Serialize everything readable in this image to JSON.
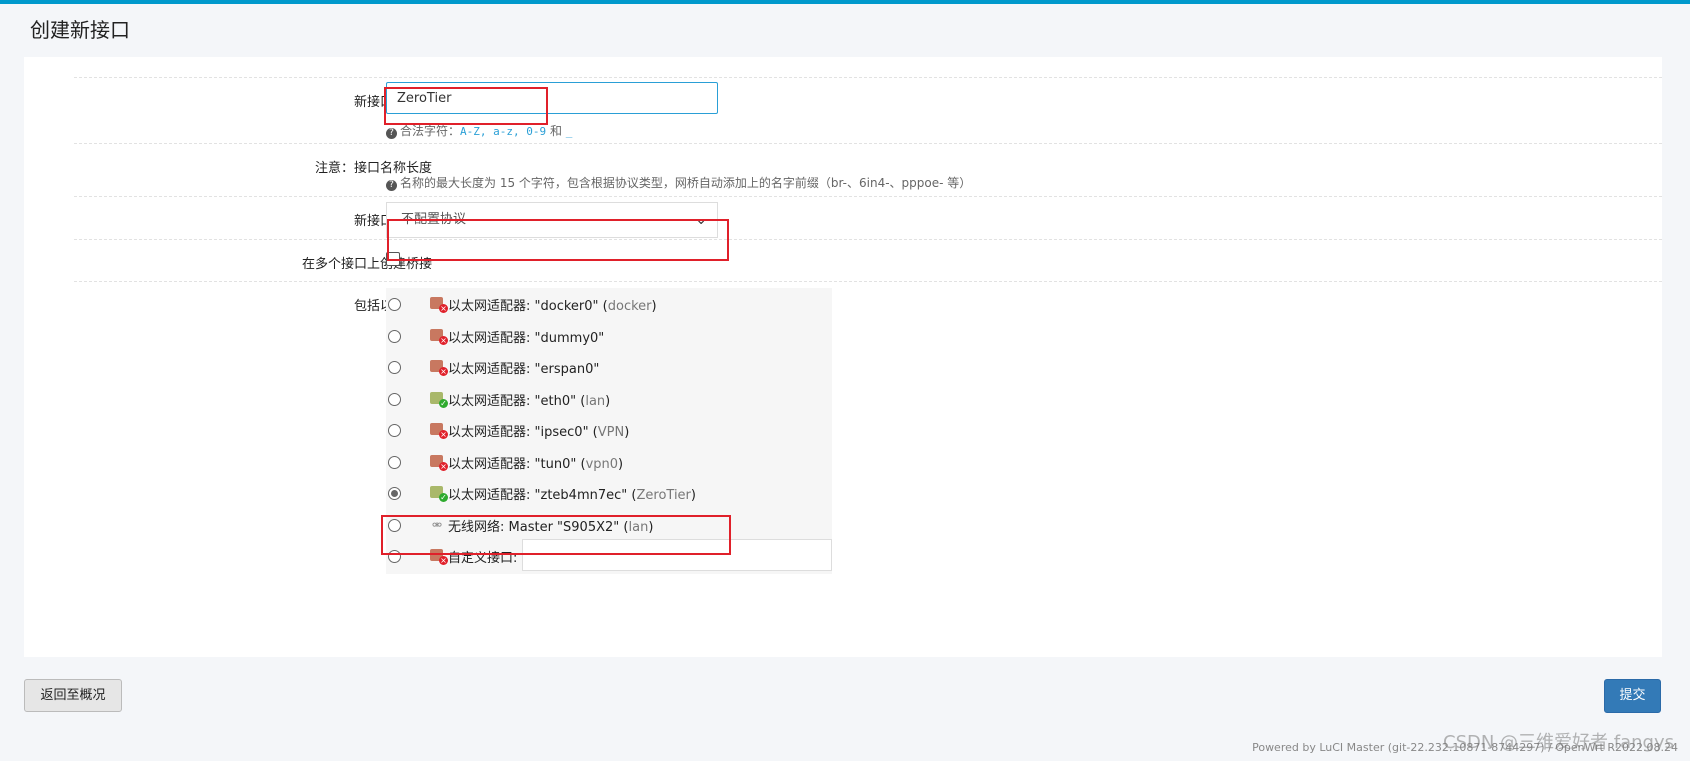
{
  "header": {
    "title": "创建新接口"
  },
  "fields": {
    "name": {
      "label": "新接口的名称",
      "value": "ZeroTier",
      "help_prefix": "合法字符：",
      "help_codes": "A-Z, a-z, 0-9",
      "help_and": "和",
      "help_underscore": "_"
    },
    "note": {
      "label": "注意：接口名称长度",
      "help": "名称的最大长度为 15 个字符，包含根据协议类型，网桥自动添加上的名字前缀（br-、6in4-、pppoe- 等）"
    },
    "protocol": {
      "label": "新接口的协议",
      "selected": "不配置协议"
    },
    "bridge": {
      "label": "在多个接口上创建桥接",
      "checked": false
    },
    "include": {
      "label": "包括以下接口"
    }
  },
  "interfaces": [
    {
      "type": "以太网适配器:",
      "name": "\"docker0\"",
      "net": "docker",
      "status": "down",
      "selected": false
    },
    {
      "type": "以太网适配器:",
      "name": "\"dummy0\"",
      "net": "",
      "status": "down",
      "selected": false
    },
    {
      "type": "以太网适配器:",
      "name": "\"erspan0\"",
      "net": "",
      "status": "down",
      "selected": false
    },
    {
      "type": "以太网适配器:",
      "name": "\"eth0\"",
      "net": "lan",
      "status": "up",
      "selected": false
    },
    {
      "type": "以太网适配器:",
      "name": "\"ipsec0\"",
      "net": "VPN",
      "status": "down",
      "selected": false
    },
    {
      "type": "以太网适配器:",
      "name": "\"tun0\"",
      "net": "vpn0",
      "status": "down",
      "selected": false
    },
    {
      "type": "以太网适配器:",
      "name": "\"zteb4mn7ec\"",
      "net": "ZeroTier",
      "status": "up",
      "selected": true
    },
    {
      "type": "无线网络:",
      "name": "Master \"S905X2\"",
      "net": "lan",
      "status": "wifi",
      "selected": false
    },
    {
      "type": "自定义接口:",
      "name": "",
      "net": "",
      "status": "down",
      "selected": false
    }
  ],
  "buttons": {
    "back": "返回至概况",
    "submit": "提交"
  },
  "footer": {
    "text": "Powered by LuCI Master (git-22.232.10871-8744297) / OpenWrt R2022.08.24"
  },
  "watermark": "CSDN @三维爱好者 fangys",
  "colors": {
    "accent": "#0099cc",
    "primary_button": "#337ab7",
    "highlight_box": "#e0202a"
  }
}
